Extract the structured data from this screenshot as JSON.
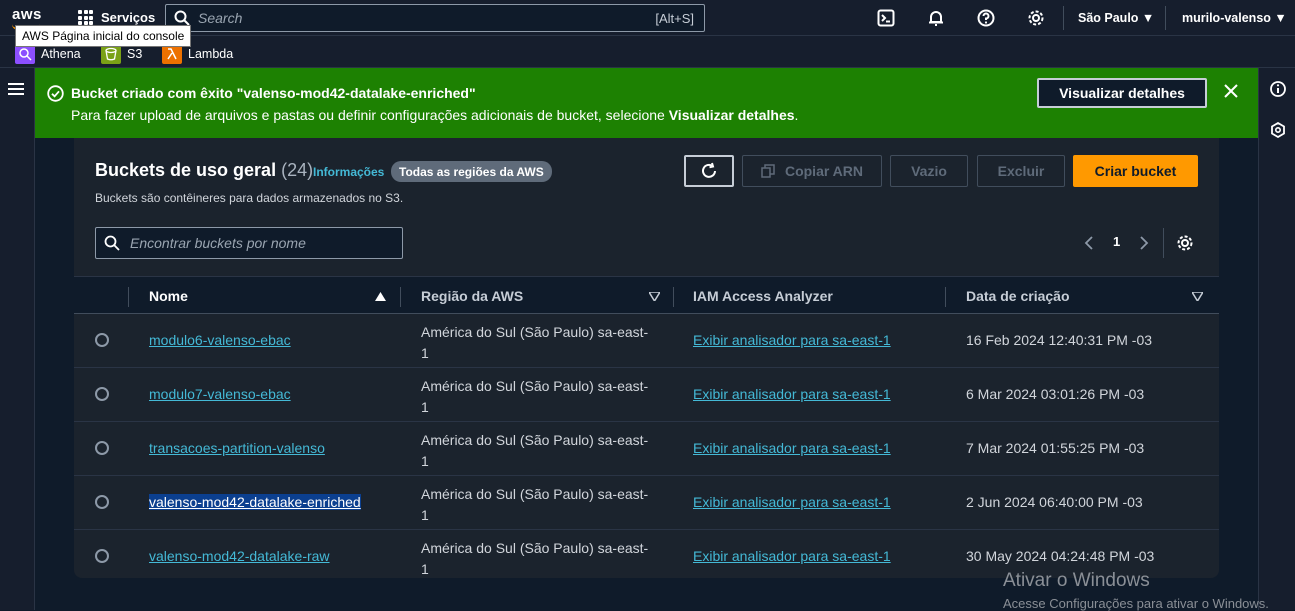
{
  "topbar": {
    "logo": "aws",
    "services_label": "Serviços",
    "search_placeholder": "Search",
    "search_shortcut": "[Alt+S]",
    "region": "São Paulo",
    "user": "murilo-valenso",
    "tooltip": "AWS Página inicial do console"
  },
  "favorites": [
    {
      "label": "Athena",
      "color": "#8c4fff"
    },
    {
      "label": "S3",
      "color": "#7aa116"
    },
    {
      "label": "Lambda",
      "color": "#ed7100"
    }
  ],
  "flash": {
    "title": "Bucket criado com êxito \"valenso-mod42-datalake-enriched\"",
    "desc_prefix": "Para fazer upload de arquivos e pastas ou definir configurações adicionais de bucket, selecione ",
    "desc_link": "Visualizar detalhes",
    "desc_suffix": ".",
    "button": "Visualizar detalhes",
    "color": "#1d8102"
  },
  "panel": {
    "title": "Buckets de uso geral",
    "count": "(24)",
    "info": "Informações",
    "badge": "Todas as regiões da AWS",
    "description": "Buckets são contêineres para dados armazenados no S3.",
    "buttons": {
      "copy_arn": "Copiar ARN",
      "empty": "Vazio",
      "delete": "Excluir",
      "create": "Criar bucket"
    },
    "filter_placeholder": "Encontrar buckets por nome",
    "page": "1"
  },
  "table": {
    "columns": [
      "Nome",
      "Região da AWS",
      "IAM Access Analyzer",
      "Data de criação"
    ],
    "rows": [
      {
        "name": "modulo6-valenso-ebac",
        "region_line1": "América do Sul (São Paulo) sa-east-",
        "region_line2": "1",
        "iam": "Exibir analisador para sa-east-1",
        "date": "16 Feb 2024 12:40:31 PM -03"
      },
      {
        "name": "modulo7-valenso-ebac",
        "region_line1": "América do Sul (São Paulo) sa-east-",
        "region_line2": "1",
        "iam": "Exibir analisador para sa-east-1",
        "date": "6 Mar 2024 03:01:26 PM -03"
      },
      {
        "name": "transacoes-partition-valenso",
        "region_line1": "América do Sul (São Paulo) sa-east-",
        "region_line2": "1",
        "iam": "Exibir analisador para sa-east-1",
        "date": "7 Mar 2024 01:55:25 PM -03"
      },
      {
        "name": "valenso-mod42-datalake-enriched",
        "region_line1": "América do Sul (São Paulo) sa-east-",
        "region_line2": "1",
        "iam": "Exibir analisador para sa-east-1",
        "date": "2 Jun 2024 06:40:00 PM -03"
      },
      {
        "name": "valenso-mod42-datalake-raw",
        "region_line1": "América do Sul (São Paulo) sa-east-",
        "region_line2": "1",
        "iam": "Exibir analisador para sa-east-1",
        "date": "30 May 2024 04:24:48 PM -03"
      }
    ]
  },
  "watermark": {
    "line1": "Ativar o Windows",
    "line2": "Acesse Configurações para ativar o Windows."
  }
}
